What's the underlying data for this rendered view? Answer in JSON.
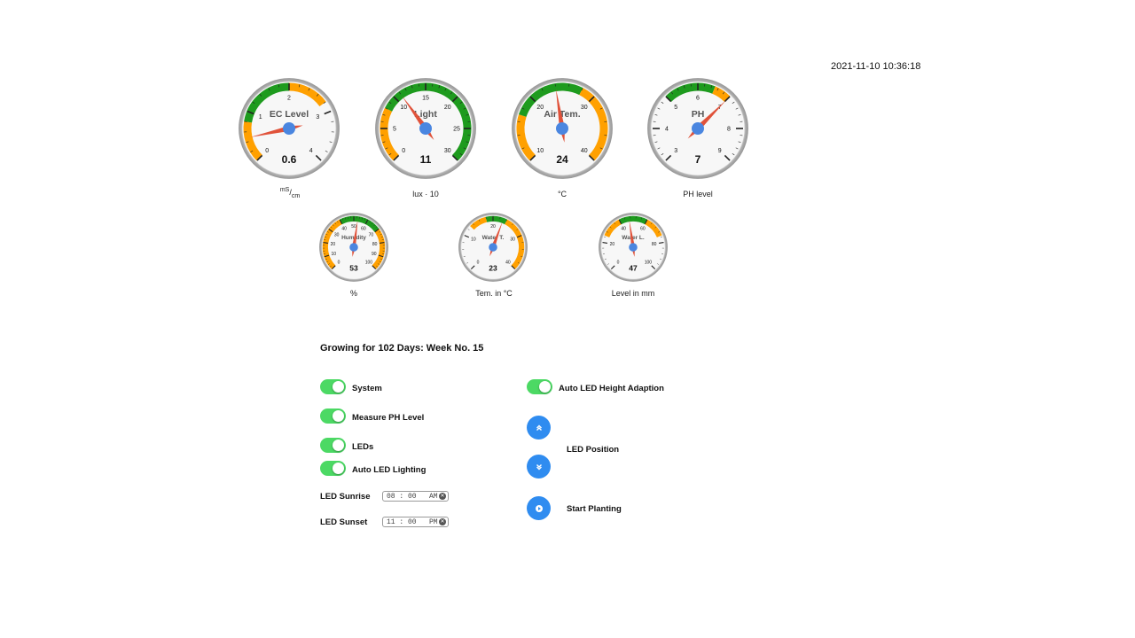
{
  "header": {
    "timestamp": "2021-11-10 10:36:18"
  },
  "colors": {
    "green": "#1e9b1e",
    "orange": "#ffa000",
    "needle": "#e0523a",
    "hub": "#4a86e0",
    "toggle_on": "#4cd964",
    "button": "#2f8cf0"
  },
  "gauges": [
    {
      "id": "ec",
      "title": "EC Level",
      "value": "0.6",
      "num": 0.6,
      "min": 0,
      "max": 5,
      "ticks": [
        "0",
        "1",
        "2",
        "3",
        "4"
      ],
      "unit_main": "mS",
      "unit_sub": "cm",
      "bands": [
        {
          "from": 0,
          "to": 1.0,
          "color": "orange"
        },
        {
          "from": 1.0,
          "to": 2.5,
          "color": "green"
        },
        {
          "from": 2.5,
          "to": 3.5,
          "color": "orange"
        }
      ]
    },
    {
      "id": "light",
      "title": "Light",
      "value": "11",
      "num": 11,
      "min": 0,
      "max": 30,
      "ticks": [
        "0",
        "5",
        "10",
        "15",
        "20",
        "25",
        "30"
      ],
      "unit": "lux · 10",
      "bands": [
        {
          "from": 0,
          "to": 8,
          "color": "orange"
        },
        {
          "from": 8,
          "to": 30,
          "color": "green"
        }
      ]
    },
    {
      "id": "air",
      "title": "Air Tem.",
      "value": "24",
      "num": 24,
      "min": 10,
      "max": 40,
      "ticks": [
        "10",
        "20",
        "30",
        "40"
      ],
      "unit": "°C",
      "bands": [
        {
          "from": 10,
          "to": 17,
          "color": "orange"
        },
        {
          "from": 17,
          "to": 28,
          "color": "green"
        },
        {
          "from": 28,
          "to": 40,
          "color": "orange"
        }
      ]
    },
    {
      "id": "ph",
      "title": "PH",
      "value": "7",
      "num": 7,
      "min": 3,
      "max": 9,
      "ticks": [
        "3",
        "4",
        "5",
        "6",
        "7",
        "8",
        "9"
      ],
      "unit": "PH level",
      "bands": [
        {
          "from": 5,
          "to": 6.5,
          "color": "green"
        },
        {
          "from": 6.5,
          "to": 7,
          "color": "orange"
        }
      ]
    },
    {
      "id": "humidity",
      "title": "Humidity",
      "value": "53",
      "num": 53,
      "min": 0,
      "max": 100,
      "ticks": [
        "0",
        "10",
        "20",
        "30",
        "40",
        "50",
        "60",
        "70",
        "80",
        "90",
        "100"
      ],
      "unit": "%",
      "bands": [
        {
          "from": 0,
          "to": 40,
          "color": "orange"
        },
        {
          "from": 40,
          "to": 70,
          "color": "green"
        },
        {
          "from": 70,
          "to": 100,
          "color": "orange"
        }
      ]
    },
    {
      "id": "water_t",
      "title": "Water T.",
      "value": "23",
      "num": 23,
      "min": 0,
      "max": 40,
      "ticks": [
        "0",
        "10",
        "20",
        "30",
        "40"
      ],
      "unit": "Tem. in °C",
      "bands": [
        {
          "from": 13,
          "to": 18,
          "color": "orange"
        },
        {
          "from": 18,
          "to": 24,
          "color": "green"
        },
        {
          "from": 24,
          "to": 40,
          "color": "orange"
        }
      ]
    },
    {
      "id": "water_l",
      "title": "Water L.",
      "value": "47",
      "num": 47,
      "min": 0,
      "max": 100,
      "ticks": [
        "0",
        "20",
        "40",
        "60",
        "80",
        "100"
      ],
      "unit": "Level in mm",
      "bands": [
        {
          "from": 25,
          "to": 40,
          "color": "orange"
        },
        {
          "from": 40,
          "to": 60,
          "color": "green"
        },
        {
          "from": 60,
          "to": 75,
          "color": "orange"
        }
      ]
    }
  ],
  "status": {
    "growing": "Growing for 102 Days: Week No. 15"
  },
  "toggles": [
    {
      "label": "System",
      "on": true
    },
    {
      "label": "Measure PH Level",
      "on": true
    },
    {
      "label": "LEDs",
      "on": true
    },
    {
      "label": "Auto LED Lighting",
      "on": true
    },
    {
      "label": "Auto LED Height Adaption",
      "on": true
    }
  ],
  "times": [
    {
      "label": "LED Sunrise",
      "value": "08 : 00   AM"
    },
    {
      "label": "LED Sunset",
      "value": "11 : 00   PM"
    }
  ],
  "buttons": {
    "led_position": "LED Position",
    "start_planting": "Start Planting"
  },
  "icons": {
    "up": "double-chevron-up-icon",
    "down": "double-chevron-down-icon",
    "play": "play-icon"
  }
}
